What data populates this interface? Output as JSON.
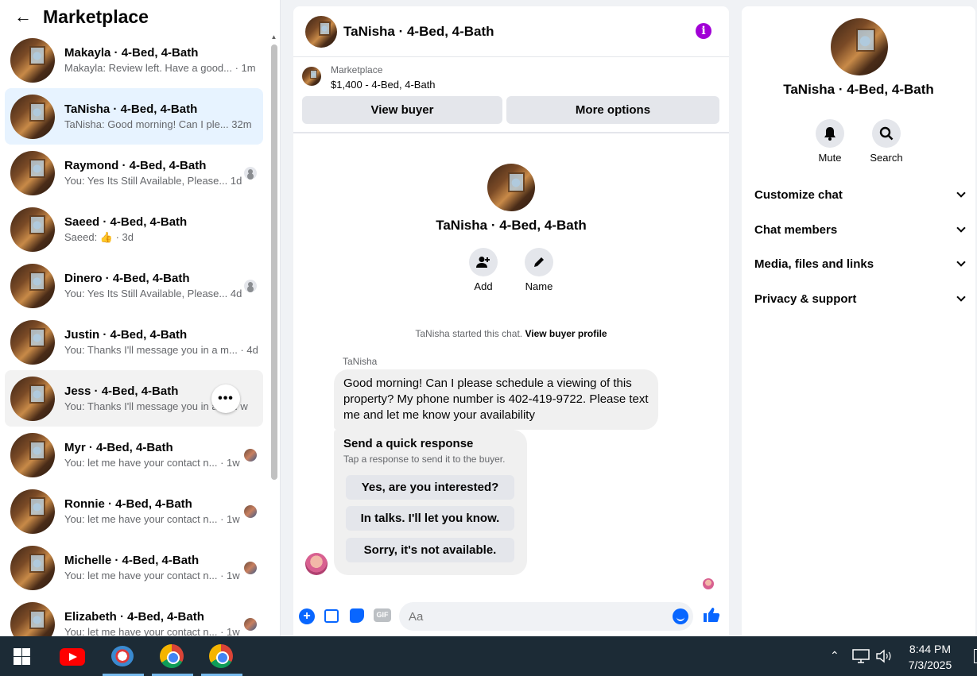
{
  "sidebar": {
    "back_label": "←",
    "title": "Marketplace",
    "conversations": [
      {
        "name": "Makayla · 4-Bed, 4-Bath",
        "preview": "Makayla: Review left. Have a good... · 1m"
      },
      {
        "name": "TaNisha · 4-Bed, 4-Bath",
        "preview": "TaNisha: Good morning! Can I ple... 32m"
      },
      {
        "name": "Raymond · 4-Bed, 4-Bath",
        "preview": "You: Yes Its Still Available, Please... 1d"
      },
      {
        "name": "Saeed · 4-Bed, 4-Bath",
        "preview": "Saeed: 👍 · 3d"
      },
      {
        "name": "Dinero · 4-Bed, 4-Bath",
        "preview": "You: Yes Its Still Available, Please... 4d"
      },
      {
        "name": "Justin · 4-Bed, 4-Bath",
        "preview": "You: Thanks I'll message you in a m... · 4d"
      },
      {
        "name": "Jess · 4-Bed, 4-Bath",
        "preview": "You: Thanks I'll message you in a m... w"
      },
      {
        "name": "Myr · 4-Bed, 4-Bath",
        "preview": "You: let me have your contact n... · 1w"
      },
      {
        "name": "Ronnie · 4-Bed, 4-Bath",
        "preview": "You: let me have your contact n... · 1w"
      },
      {
        "name": "Michelle · 4-Bed, 4-Bath",
        "preview": "You: let me have your contact n... · 1w"
      },
      {
        "name": "Elizabeth · 4-Bed, 4-Bath",
        "preview": "You: let me have your contact n... · 1w"
      }
    ],
    "more_label": "•••"
  },
  "chat": {
    "header_title": "TaNisha · 4-Bed, 4-Bath",
    "info_glyph": "i",
    "listing_source": "Marketplace",
    "listing_price": "$1,400 - 4-Bed, 4-Bath",
    "view_buyer_label": "View buyer",
    "more_options_label": "More options",
    "intro_name": "TaNisha · 4-Bed, 4-Bath",
    "add_label": "Add",
    "name_label": "Name",
    "started_text": "TaNisha started this chat.",
    "view_profile_label": "View buyer profile",
    "sender": "TaNisha",
    "message": "Good morning! Can I please schedule a viewing of this property? My phone number is 402-419-9722. Please text me and let me know your availability",
    "quick_title": "Send a quick response",
    "quick_sub": "Tap a response to send it to the buyer.",
    "quick_responses": [
      "Yes, are you interested?",
      "In talks. I'll let you know.",
      "Sorry, it's not available."
    ],
    "input_placeholder": "Aa",
    "gif_label": "GIF"
  },
  "panel": {
    "name": "TaNisha · 4-Bed, 4-Bath",
    "mute_label": "Mute",
    "search_label": "Search",
    "rows": [
      "Customize chat",
      "Chat members",
      "Media, files and links",
      "Privacy & support"
    ]
  },
  "taskbar": {
    "time": "8:44 PM",
    "date": "7/3/2025"
  },
  "colors": {
    "accent": "#0866ff",
    "info": "#a100d6",
    "active_row": "#e7f3ff",
    "taskbar": "#1c2b36"
  }
}
